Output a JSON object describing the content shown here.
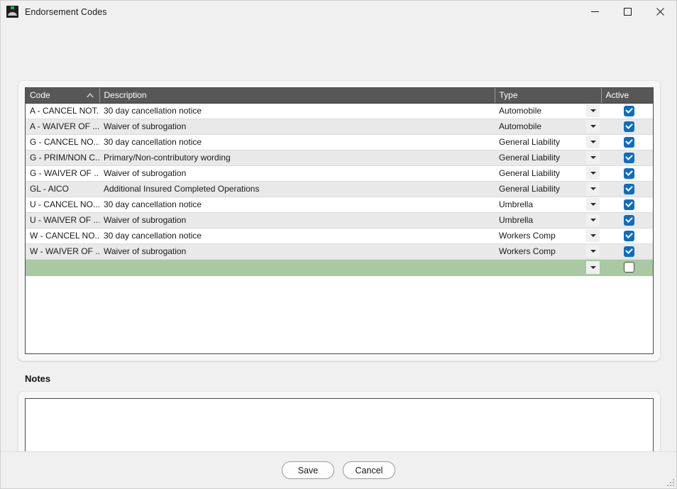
{
  "window": {
    "title": "Endorsement Codes",
    "icon": "app-icon",
    "controls": {
      "minimize": "minimize-icon",
      "maximize": "maximize-icon",
      "close": "close-icon"
    }
  },
  "grid": {
    "columns": [
      {
        "key": "code",
        "label": "Code",
        "sort": "ascending"
      },
      {
        "key": "description",
        "label": "Description"
      },
      {
        "key": "type",
        "label": "Type"
      },
      {
        "key": "active",
        "label": "Active"
      }
    ],
    "rows": [
      {
        "code": "A - CANCEL NOT...",
        "description": "30 day cancellation notice",
        "type": "Automobile",
        "active": true
      },
      {
        "code": "A - WAIVER OF ...",
        "description": "Waiver of subrogation",
        "type": "Automobile",
        "active": true
      },
      {
        "code": "G - CANCEL NO...",
        "description": "30 day cancellation notice",
        "type": "General Liability",
        "active": true
      },
      {
        "code": "G - PRIM/NON C...",
        "description": "Primary/Non-contributory wording",
        "type": "General Liability",
        "active": true
      },
      {
        "code": "G - WAIVER OF ...",
        "description": "Waiver of subrogation",
        "type": "General Liability",
        "active": true
      },
      {
        "code": "GL - AICO",
        "description": "Additional Insured Completed Operations",
        "type": "General Liability",
        "active": true
      },
      {
        "code": "U - CANCEL NO...",
        "description": "30 day cancellation notice",
        "type": "Umbrella",
        "active": true
      },
      {
        "code": "U - WAIVER OF ...",
        "description": "Waiver of subrogation",
        "type": "Umbrella",
        "active": true
      },
      {
        "code": "W - CANCEL NO...",
        "description": "30 day cancellation notice",
        "type": "Workers Comp",
        "active": true
      },
      {
        "code": "W - WAIVER OF ...",
        "description": "Waiver of subrogation",
        "type": "Workers Comp",
        "active": true
      }
    ],
    "new_row": {
      "code": "",
      "description": "",
      "type": "",
      "active": false
    }
  },
  "notes": {
    "label": "Notes",
    "value": "",
    "placeholder": ""
  },
  "footer": {
    "save_label": "Save",
    "cancel_label": "Cancel"
  },
  "colors": {
    "header_bg": "#575757",
    "new_row_bg": "#a9c9a2",
    "checkbox_on": "#0b6ec4",
    "alt_row_bg": "#e9e9e9"
  }
}
